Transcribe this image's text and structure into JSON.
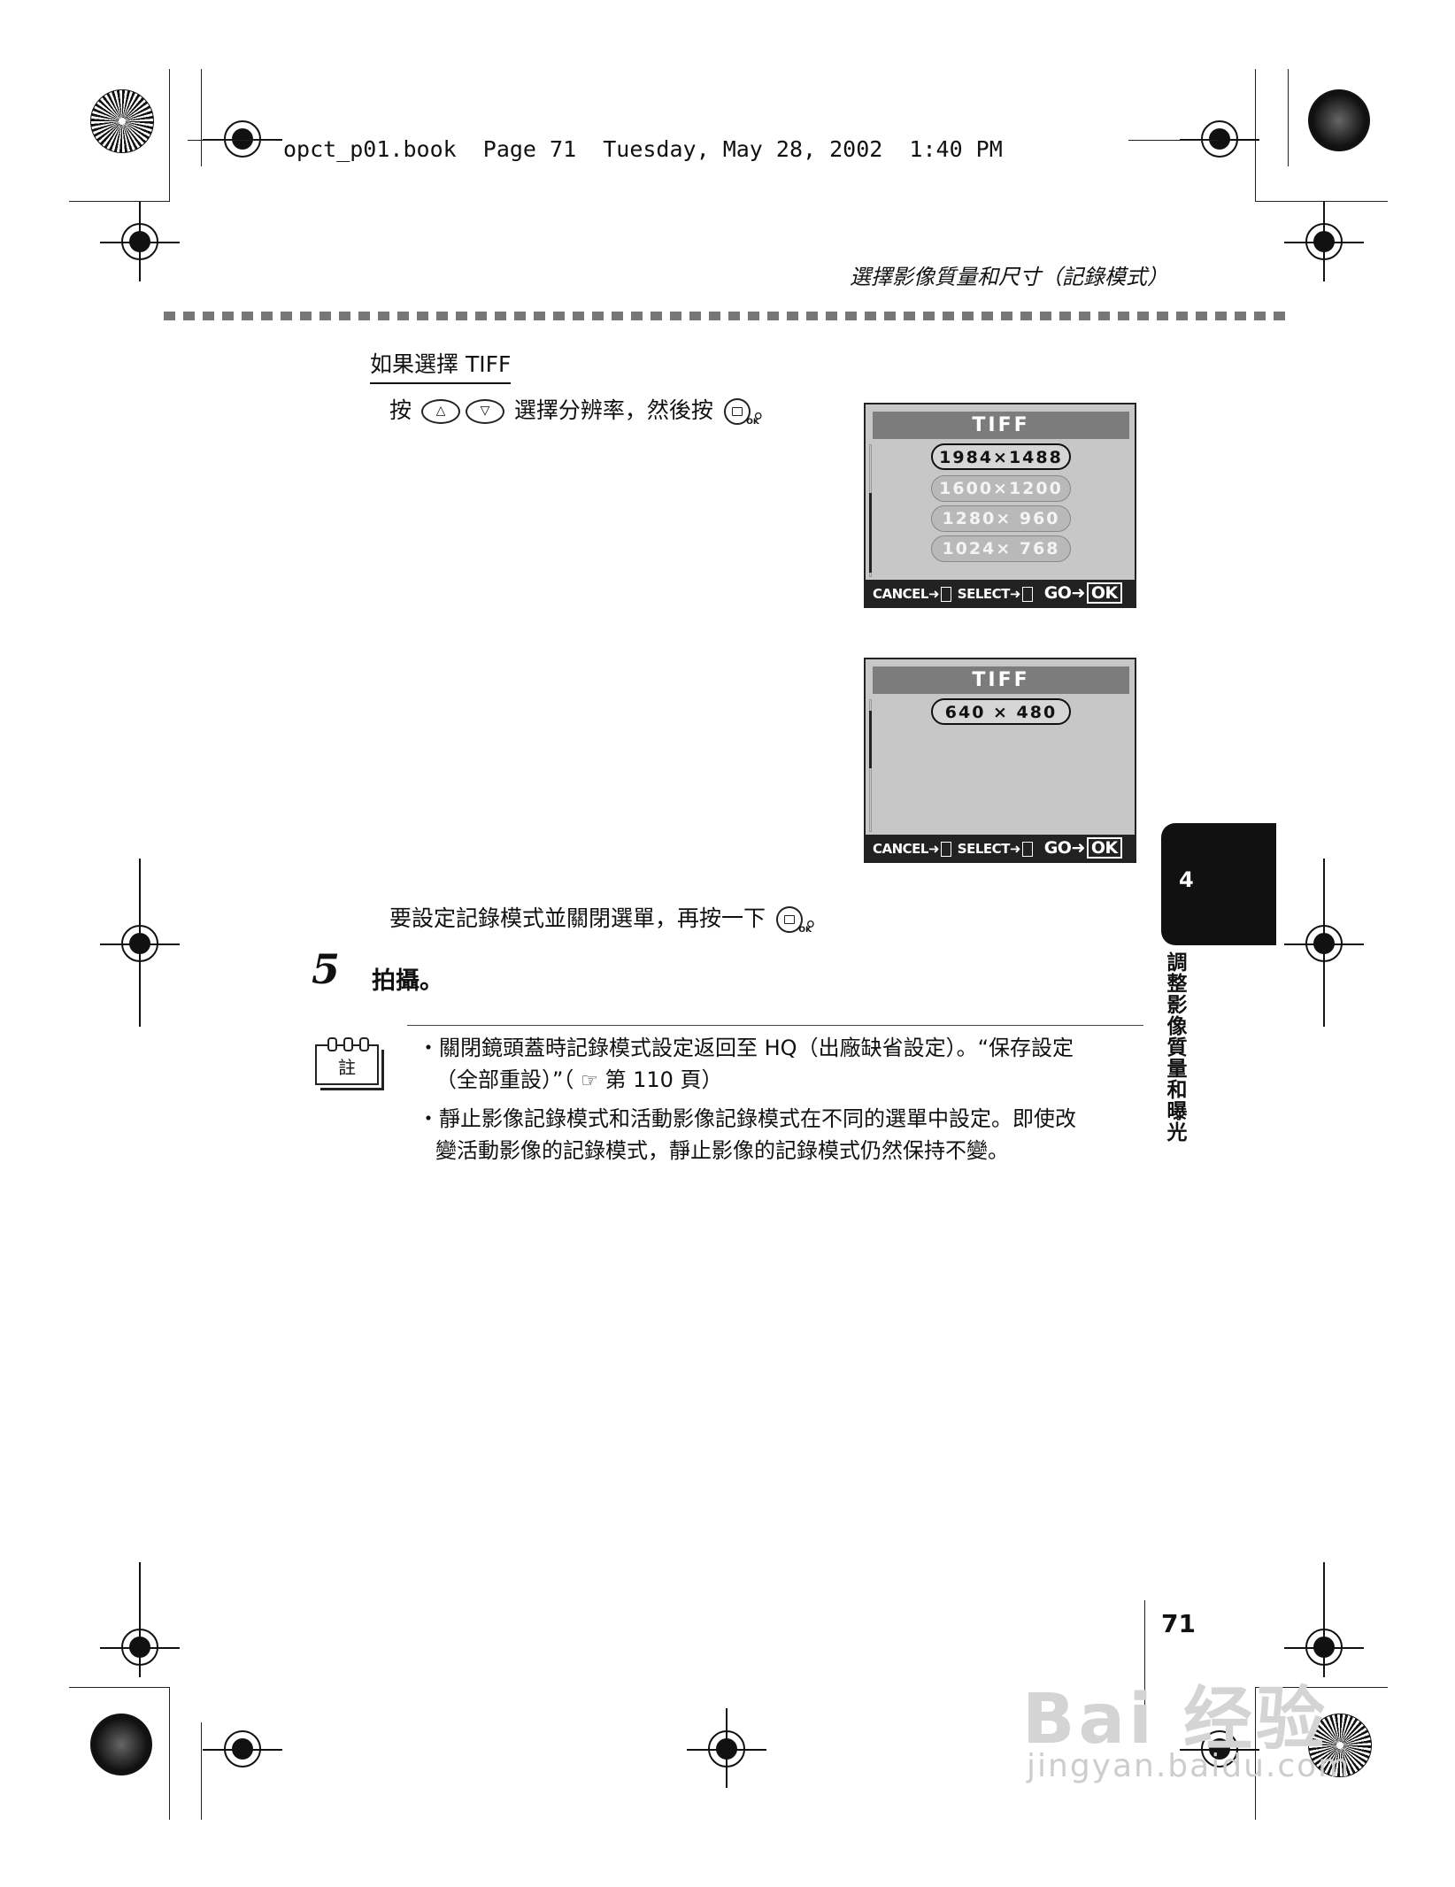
{
  "print_header": {
    "slug": "opct_p01.book  Page 71  Tuesday, May 28, 2002  1:40 PM"
  },
  "running_head": "選擇影像質量和尺寸（記錄模式）",
  "section": {
    "heading": "如果選擇 TIFF",
    "instruction_pre": "按",
    "instruction_mid": "選擇分辨率，然後按",
    "instruction_end": "。"
  },
  "screen1": {
    "title": "TIFF",
    "options": [
      {
        "label": "1984×1488",
        "selected": true
      },
      {
        "label": "1600×1200",
        "selected": false
      },
      {
        "label": "1280× 960",
        "selected": false
      },
      {
        "label": "1024× 768",
        "selected": false
      }
    ],
    "footer": {
      "cancel": "CANCEL➜",
      "select": "SELECT➜",
      "go": "GO➜",
      "ok": "OK"
    }
  },
  "screen2": {
    "title": "TIFF",
    "options": [
      {
        "label": "640 × 480",
        "selected": true
      }
    ],
    "footer": {
      "cancel": "CANCEL➜",
      "select": "SELECT➜",
      "go": "GO➜",
      "ok": "OK"
    }
  },
  "confirm_line": {
    "text": "要設定記錄模式並關閉選單，再按一下",
    "end": "。"
  },
  "step5": {
    "number": "5",
    "text": "拍攝。"
  },
  "note": {
    "icon_label": "註",
    "items": [
      {
        "line1": "關閉鏡頭蓋時記錄模式設定返回至 HQ（出廠缺省設定）。“保存設定",
        "line2_pre": "（全部重設）”（",
        "line2_ref": "第 110 頁）"
      },
      {
        "line1": "靜止影像記錄模式和活動影像記錄模式在不同的選單中設定。即使改",
        "line2": "變活動影像的記錄模式，靜止影像的記錄模式仍然保持不變。"
      }
    ]
  },
  "side_tab": {
    "chapter": "4",
    "title": "調整影像質量和曝光"
  },
  "page_number": "71",
  "watermark": {
    "brand": "Bai 经验",
    "url": "jingyan.baidu.com"
  },
  "icons": {
    "ok_button": "ok-button-icon",
    "up_button": "up-arrow-button-icon",
    "down_button": "down-arrow-button-icon",
    "reference": "pointing-hand-icon"
  }
}
